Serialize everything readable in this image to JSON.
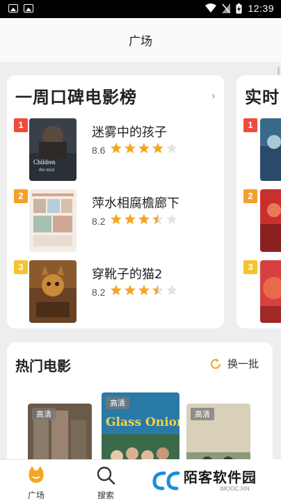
{
  "status_bar": {
    "time": "12:39"
  },
  "header": {
    "title": "广场"
  },
  "weekly_card": {
    "title": "一周口碑电影榜",
    "movies": [
      {
        "rank": "1",
        "title": "迷雾中的孩子",
        "score": "8.6",
        "stars": 4
      },
      {
        "rank": "2",
        "title": "萍水相腐檐廊下",
        "score": "8.2",
        "stars": 3.5
      },
      {
        "rank": "3",
        "title": "穿靴子的猫2",
        "score": "8.2",
        "stars": 3.5
      }
    ],
    "poster_texts": {
      "children": "Children\nthe mist"
    }
  },
  "realtime_card": {
    "title": "实时",
    "ranks": [
      "1",
      "2",
      "3"
    ]
  },
  "hot_card": {
    "title": "热门电影",
    "refresh_label": "换一批",
    "badges": [
      "高清",
      "高清",
      "高清"
    ],
    "poster_texts": {
      "glass_onion": "Glass Onion"
    }
  },
  "tabbar": {
    "tabs": [
      {
        "label": "广场"
      },
      {
        "label": "搜索"
      }
    ]
  },
  "watermark": {
    "text": "陌客软件园",
    "sub": "IMOOC.XIN"
  },
  "colors": {
    "accent": "#f5a623",
    "rank1": "#f24a3a",
    "rank2": "#f5a02a",
    "rank3": "#f5c42a"
  }
}
